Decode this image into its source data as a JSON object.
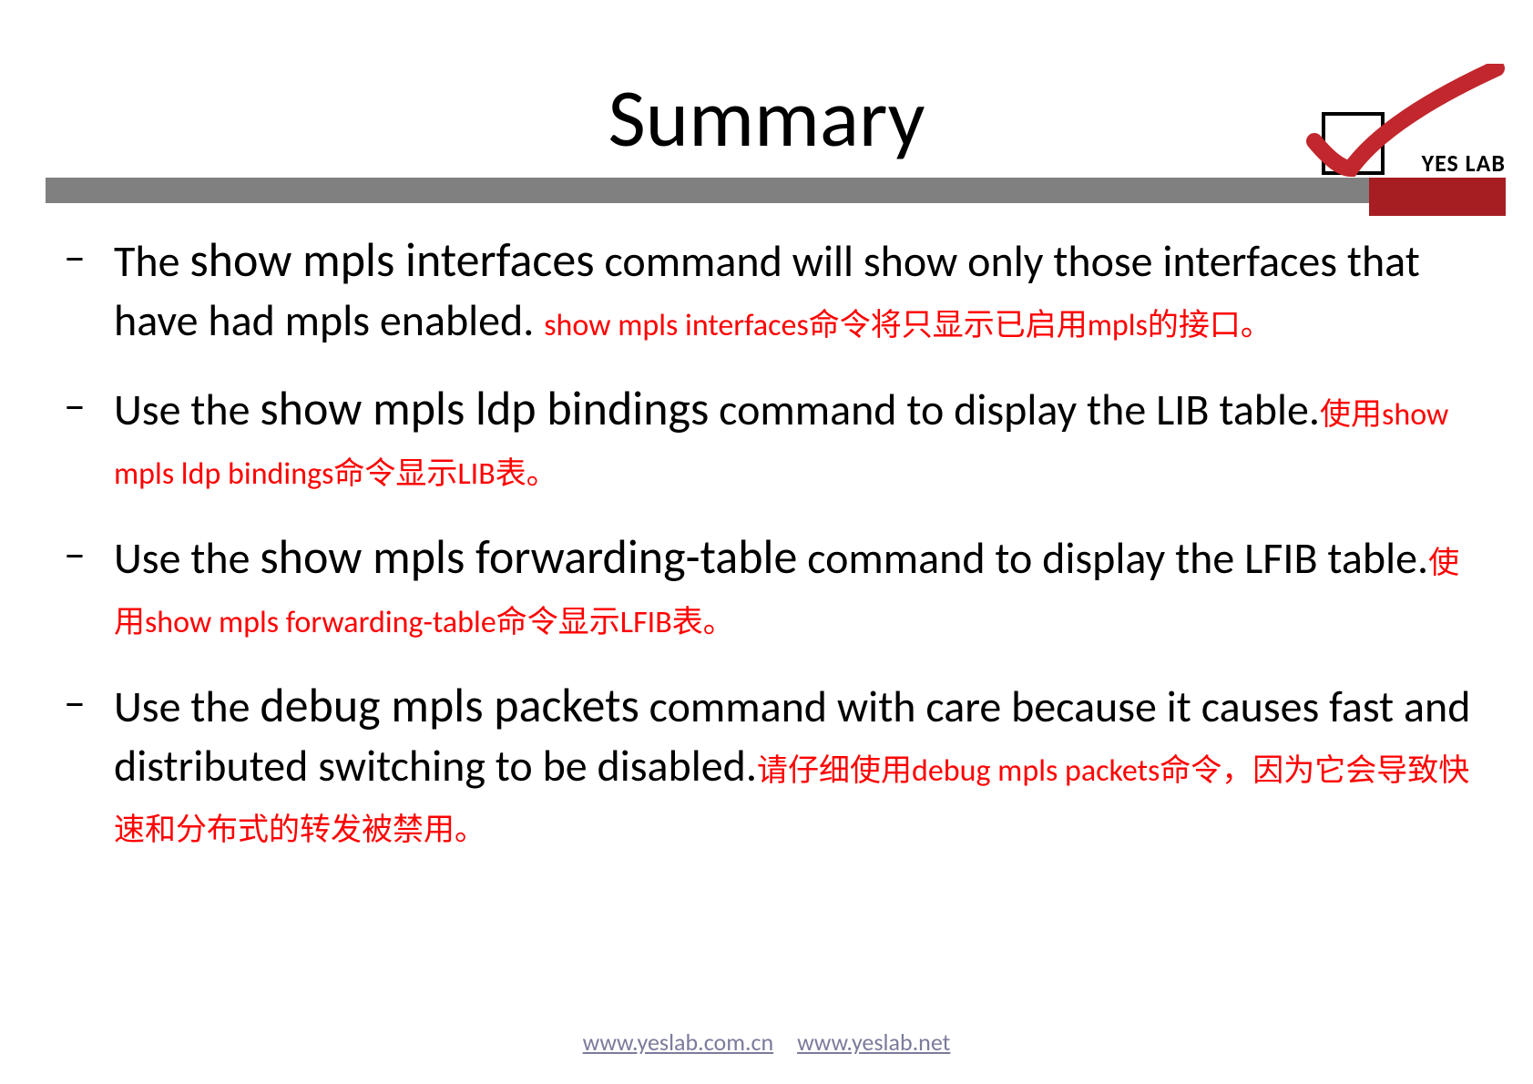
{
  "title": "Summary",
  "logo_text": "YES LAB",
  "bullets": [
    {
      "pre": "The ",
      "cmd": "show mpls interfaces",
      "post": " command will show  only those interfaces that have had mpls enabled. ",
      "trans": "show mpls interfaces命令将只显示已启用mpls的接口。"
    },
    {
      "pre": "Use the ",
      "cmd": "show mpls ldp bindings",
      "post": " command to  display the LIB table.",
      "trans": "使用show mpls ldp bindings命令显示LIB表。"
    },
    {
      "pre": "Use the ",
      "cmd": "show mpls forwarding-table",
      "post": " command  to display the LFIB table.",
      "trans": "使用show mpls forwarding-table命令显示LFIB表。"
    },
    {
      "pre": "Use the ",
      "cmd": "debug mpls packets",
      "post": " command with  care because it causes fast and distributed  switching to be disabled.",
      "trans": "请仔细使用debug mpls packets命令，因为它会导致快速和分布式的转发被禁用。"
    }
  ],
  "footer": {
    "link1": "www.yeslab.com.cn",
    "link2": "www.yeslab.net"
  }
}
